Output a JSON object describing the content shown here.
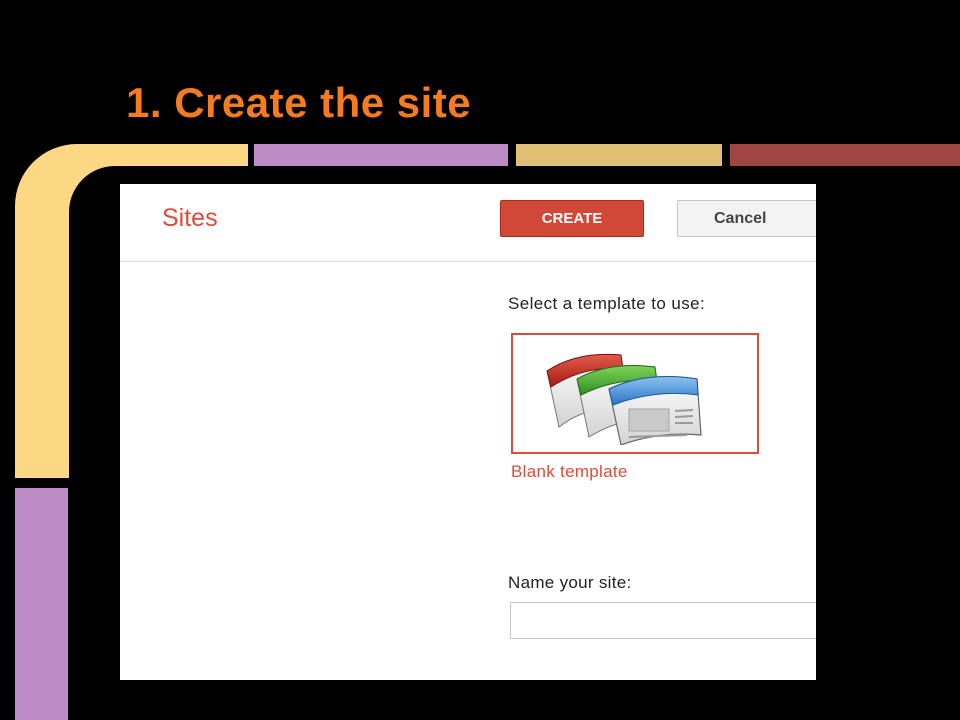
{
  "slide": {
    "title": "1.  Create the site"
  },
  "app": {
    "name": "Sites",
    "create_label": "CREATE",
    "cancel_label": "Cancel",
    "template_prompt": "Select a template to use:",
    "template_name": "Blank template",
    "template_icon": "site-pages-icon",
    "name_prompt": "Name your site:",
    "name_value": "",
    "name_placeholder": ""
  },
  "colors": {
    "title_orange": "#f47b20",
    "accent_red": "#dd4b39",
    "create_button": "#d14836",
    "deco_yellow": "#fcd884",
    "deco_purple": "#bd8bc6",
    "deco_gold": "#dfc075",
    "deco_red": "#a14543"
  }
}
